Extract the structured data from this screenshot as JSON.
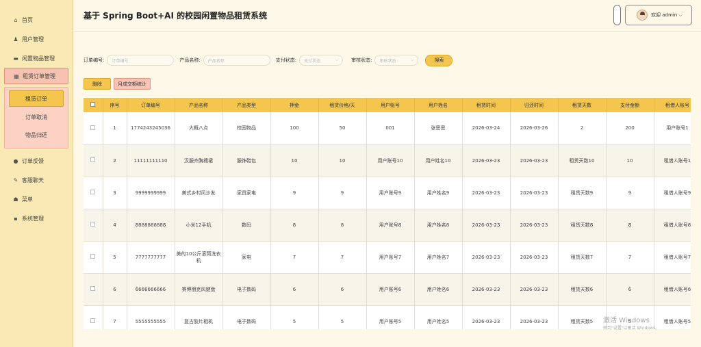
{
  "header": {
    "title": "基于 Spring Boot+AI 的校园闲置物品租赁系统",
    "user_text": "欢迎 admin ⌵"
  },
  "sidebar": {
    "items": [
      {
        "label": "首页",
        "icon": "⌂"
      },
      {
        "label": "用户管理",
        "icon": "♟"
      },
      {
        "label": "闲置物品管理",
        "icon": "▬"
      },
      {
        "label": "租赁订单管理",
        "icon": "▦"
      },
      {
        "label": "订单反馈",
        "icon": "●"
      },
      {
        "label": "客服聊天",
        "icon": "✎"
      },
      {
        "label": "菜单",
        "icon": "☗"
      },
      {
        "label": "系统管理",
        "icon": "▪"
      }
    ],
    "submenu": [
      "租赁订单",
      "订单取消",
      "物品归还"
    ]
  },
  "search": {
    "order_label": "订单编号:",
    "order_placeholder": "订单编号",
    "product_label": "产品名称:",
    "product_placeholder": "产品名称",
    "pay_label": "支付状态:",
    "pay_placeholder": "支付状态",
    "review_label": "审核状态:",
    "review_placeholder": "审核状态",
    "search_button": "搜索"
  },
  "actions": {
    "delete": "删除",
    "stats": "月成交额统计"
  },
  "table": {
    "columns": [
      "序号",
      "订单编号",
      "产品名称",
      "产品类型",
      "押金",
      "租赁价格/天",
      "用户账号",
      "用户姓名",
      "租赁时间",
      "归还时间",
      "租赁天数",
      "支付金额",
      "租借人账号"
    ],
    "rows": [
      [
        "1",
        "1774243245036",
        "大概八点",
        "校园物品",
        "100",
        "50",
        "001",
        "张思思",
        "2026-03-24",
        "2026-03-26",
        "2",
        "200",
        "用户账号1"
      ],
      [
        "2",
        "11111111110",
        "汉服齐胸襦裙",
        "服饰鞋包",
        "10",
        "10",
        "用户账号10",
        "用户姓名10",
        "2026-03-23",
        "2026-03-23",
        "租赁天数10",
        "10",
        "租借人账号1"
      ],
      [
        "3",
        "9999999999",
        "美式乡村风沙发",
        "家具家电",
        "9",
        "9",
        "用户账号9",
        "用户姓名9",
        "2026-03-23",
        "2026-03-23",
        "租赁天数9",
        "9",
        "租借人账号9"
      ],
      [
        "4",
        "8888888888",
        "小米12手机",
        "数码",
        "8",
        "8",
        "用户账号8",
        "用户姓名8",
        "2026-03-23",
        "2026-03-23",
        "租赁天数8",
        "8",
        "租借人账号8"
      ],
      [
        "5",
        "7777777777",
        "美的10公斤滚筒洗衣机",
        "家电",
        "7",
        "7",
        "用户账号7",
        "用户姓名7",
        "2026-03-23",
        "2026-03-23",
        "租赁天数7",
        "7",
        "租借人账号7"
      ],
      [
        "6",
        "6666666666",
        "赛博朋克风键盘",
        "电子数码",
        "6",
        "6",
        "用户账号6",
        "用户姓名6",
        "2026-03-23",
        "2026-03-23",
        "租赁天数6",
        "6",
        "租借人账号6"
      ],
      [
        "7",
        "5555555555",
        "复古胶片相机",
        "电子数码",
        "5",
        "5",
        "用户账号5",
        "用户姓名5",
        "2026-03-23",
        "2026-03-23",
        "租赁天数5",
        "5",
        "租借人账号5"
      ]
    ]
  },
  "watermark": {
    "line1": "激活 Windows",
    "line2": "转到\"设置\"以激活 Windows。"
  }
}
